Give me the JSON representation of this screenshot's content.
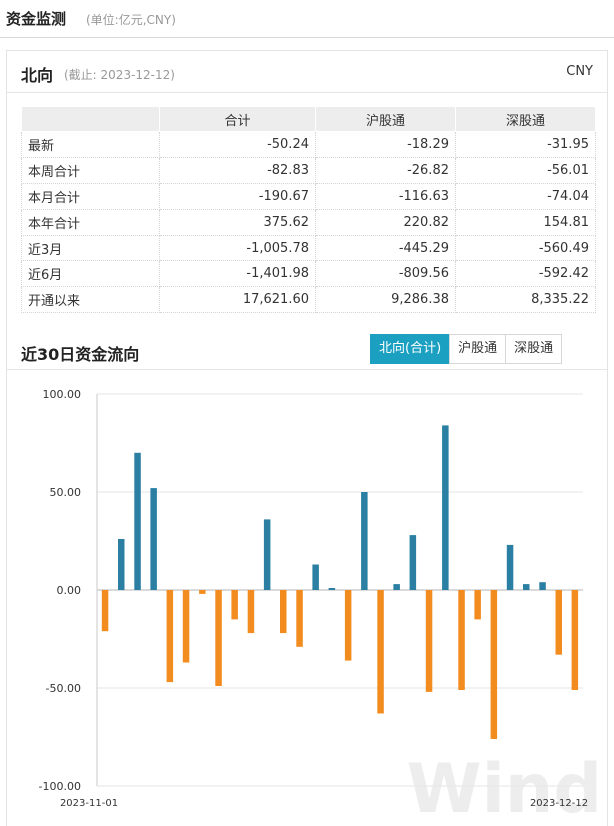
{
  "header": {
    "title": "资金监测",
    "unit": "(单位:亿元,CNY)"
  },
  "north": {
    "name": "北向",
    "date": "(截止: 2023-12-12)",
    "currency": "CNY"
  },
  "table": {
    "columns": [
      "",
      "合计",
      "沪股通",
      "深股通"
    ],
    "rows": [
      {
        "label": "最新",
        "total": "-50.24",
        "sh": "-18.29",
        "sz": "-31.95"
      },
      {
        "label": "本周合计",
        "total": "-82.83",
        "sh": "-26.82",
        "sz": "-56.01"
      },
      {
        "label": "本月合计",
        "total": "-190.67",
        "sh": "-116.63",
        "sz": "-74.04"
      },
      {
        "label": "本年合计",
        "total": "375.62",
        "sh": "220.82",
        "sz": "154.81"
      },
      {
        "label": "近3月",
        "total": "-1,005.78",
        "sh": "-445.29",
        "sz": "-560.49"
      },
      {
        "label": "近6月",
        "total": "-1,401.98",
        "sh": "-809.56",
        "sz": "-592.42"
      },
      {
        "label": "开通以来",
        "total": "17,621.60",
        "sh": "9,286.38",
        "sz": "8,335.22"
      }
    ]
  },
  "section": {
    "title": "近30日资金流向"
  },
  "tabs": [
    {
      "label": "北向(合计)",
      "active": true
    },
    {
      "label": "沪股通",
      "active": false
    },
    {
      "label": "深股通",
      "active": false
    }
  ],
  "watermark": "Wind",
  "colors": {
    "positive": "#2a7fa3",
    "negative": "#f28c1e",
    "tab_active": "#1ba0c2"
  },
  "chart_data": {
    "type": "bar",
    "ylim": [
      -100,
      100
    ],
    "yticks": [
      "100.00",
      "50.00",
      "0.00",
      "-50.00",
      "-100.00"
    ],
    "x_start_label": "2023-11-01",
    "x_end_label": "2023-12-12",
    "values": [
      -21,
      26,
      70,
      52,
      -47,
      -37,
      -2,
      -49,
      -15,
      -22,
      36,
      -22,
      -29,
      13,
      1,
      -36,
      50,
      -63,
      3,
      28,
      -52,
      84,
      -51,
      -15,
      -76,
      23,
      3,
      4,
      -33,
      -51
    ]
  }
}
